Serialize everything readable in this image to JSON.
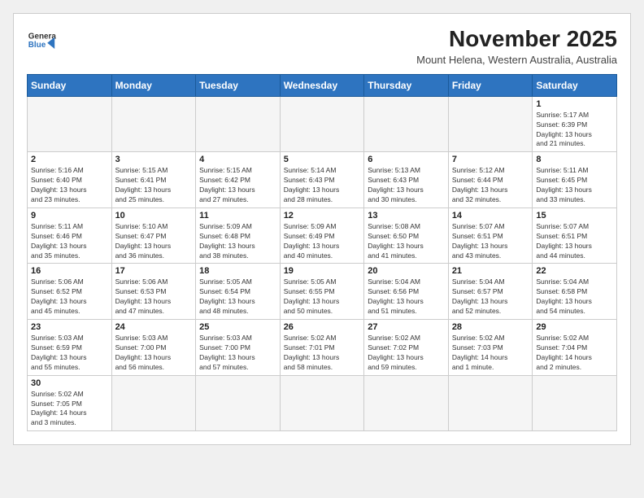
{
  "header": {
    "title": "November 2025",
    "subtitle": "Mount Helena, Western Australia, Australia",
    "logo_line1": "General",
    "logo_line2": "Blue"
  },
  "days_of_week": [
    "Sunday",
    "Monday",
    "Tuesday",
    "Wednesday",
    "Thursday",
    "Friday",
    "Saturday"
  ],
  "weeks": [
    [
      {
        "day": "",
        "info": ""
      },
      {
        "day": "",
        "info": ""
      },
      {
        "day": "",
        "info": ""
      },
      {
        "day": "",
        "info": ""
      },
      {
        "day": "",
        "info": ""
      },
      {
        "day": "",
        "info": ""
      },
      {
        "day": "1",
        "info": "Sunrise: 5:17 AM\nSunset: 6:39 PM\nDaylight: 13 hours\nand 21 minutes."
      }
    ],
    [
      {
        "day": "2",
        "info": "Sunrise: 5:16 AM\nSunset: 6:40 PM\nDaylight: 13 hours\nand 23 minutes."
      },
      {
        "day": "3",
        "info": "Sunrise: 5:15 AM\nSunset: 6:41 PM\nDaylight: 13 hours\nand 25 minutes."
      },
      {
        "day": "4",
        "info": "Sunrise: 5:15 AM\nSunset: 6:42 PM\nDaylight: 13 hours\nand 27 minutes."
      },
      {
        "day": "5",
        "info": "Sunrise: 5:14 AM\nSunset: 6:43 PM\nDaylight: 13 hours\nand 28 minutes."
      },
      {
        "day": "6",
        "info": "Sunrise: 5:13 AM\nSunset: 6:43 PM\nDaylight: 13 hours\nand 30 minutes."
      },
      {
        "day": "7",
        "info": "Sunrise: 5:12 AM\nSunset: 6:44 PM\nDaylight: 13 hours\nand 32 minutes."
      },
      {
        "day": "8",
        "info": "Sunrise: 5:11 AM\nSunset: 6:45 PM\nDaylight: 13 hours\nand 33 minutes."
      }
    ],
    [
      {
        "day": "9",
        "info": "Sunrise: 5:11 AM\nSunset: 6:46 PM\nDaylight: 13 hours\nand 35 minutes."
      },
      {
        "day": "10",
        "info": "Sunrise: 5:10 AM\nSunset: 6:47 PM\nDaylight: 13 hours\nand 36 minutes."
      },
      {
        "day": "11",
        "info": "Sunrise: 5:09 AM\nSunset: 6:48 PM\nDaylight: 13 hours\nand 38 minutes."
      },
      {
        "day": "12",
        "info": "Sunrise: 5:09 AM\nSunset: 6:49 PM\nDaylight: 13 hours\nand 40 minutes."
      },
      {
        "day": "13",
        "info": "Sunrise: 5:08 AM\nSunset: 6:50 PM\nDaylight: 13 hours\nand 41 minutes."
      },
      {
        "day": "14",
        "info": "Sunrise: 5:07 AM\nSunset: 6:51 PM\nDaylight: 13 hours\nand 43 minutes."
      },
      {
        "day": "15",
        "info": "Sunrise: 5:07 AM\nSunset: 6:51 PM\nDaylight: 13 hours\nand 44 minutes."
      }
    ],
    [
      {
        "day": "16",
        "info": "Sunrise: 5:06 AM\nSunset: 6:52 PM\nDaylight: 13 hours\nand 45 minutes."
      },
      {
        "day": "17",
        "info": "Sunrise: 5:06 AM\nSunset: 6:53 PM\nDaylight: 13 hours\nand 47 minutes."
      },
      {
        "day": "18",
        "info": "Sunrise: 5:05 AM\nSunset: 6:54 PM\nDaylight: 13 hours\nand 48 minutes."
      },
      {
        "day": "19",
        "info": "Sunrise: 5:05 AM\nSunset: 6:55 PM\nDaylight: 13 hours\nand 50 minutes."
      },
      {
        "day": "20",
        "info": "Sunrise: 5:04 AM\nSunset: 6:56 PM\nDaylight: 13 hours\nand 51 minutes."
      },
      {
        "day": "21",
        "info": "Sunrise: 5:04 AM\nSunset: 6:57 PM\nDaylight: 13 hours\nand 52 minutes."
      },
      {
        "day": "22",
        "info": "Sunrise: 5:04 AM\nSunset: 6:58 PM\nDaylight: 13 hours\nand 54 minutes."
      }
    ],
    [
      {
        "day": "23",
        "info": "Sunrise: 5:03 AM\nSunset: 6:59 PM\nDaylight: 13 hours\nand 55 minutes."
      },
      {
        "day": "24",
        "info": "Sunrise: 5:03 AM\nSunset: 7:00 PM\nDaylight: 13 hours\nand 56 minutes."
      },
      {
        "day": "25",
        "info": "Sunrise: 5:03 AM\nSunset: 7:00 PM\nDaylight: 13 hours\nand 57 minutes."
      },
      {
        "day": "26",
        "info": "Sunrise: 5:02 AM\nSunset: 7:01 PM\nDaylight: 13 hours\nand 58 minutes."
      },
      {
        "day": "27",
        "info": "Sunrise: 5:02 AM\nSunset: 7:02 PM\nDaylight: 13 hours\nand 59 minutes."
      },
      {
        "day": "28",
        "info": "Sunrise: 5:02 AM\nSunset: 7:03 PM\nDaylight: 14 hours\nand 1 minute."
      },
      {
        "day": "29",
        "info": "Sunrise: 5:02 AM\nSunset: 7:04 PM\nDaylight: 14 hours\nand 2 minutes."
      }
    ],
    [
      {
        "day": "30",
        "info": "Sunrise: 5:02 AM\nSunset: 7:05 PM\nDaylight: 14 hours\nand 3 minutes."
      },
      {
        "day": "",
        "info": ""
      },
      {
        "day": "",
        "info": ""
      },
      {
        "day": "",
        "info": ""
      },
      {
        "day": "",
        "info": ""
      },
      {
        "day": "",
        "info": ""
      },
      {
        "day": "",
        "info": ""
      }
    ]
  ]
}
